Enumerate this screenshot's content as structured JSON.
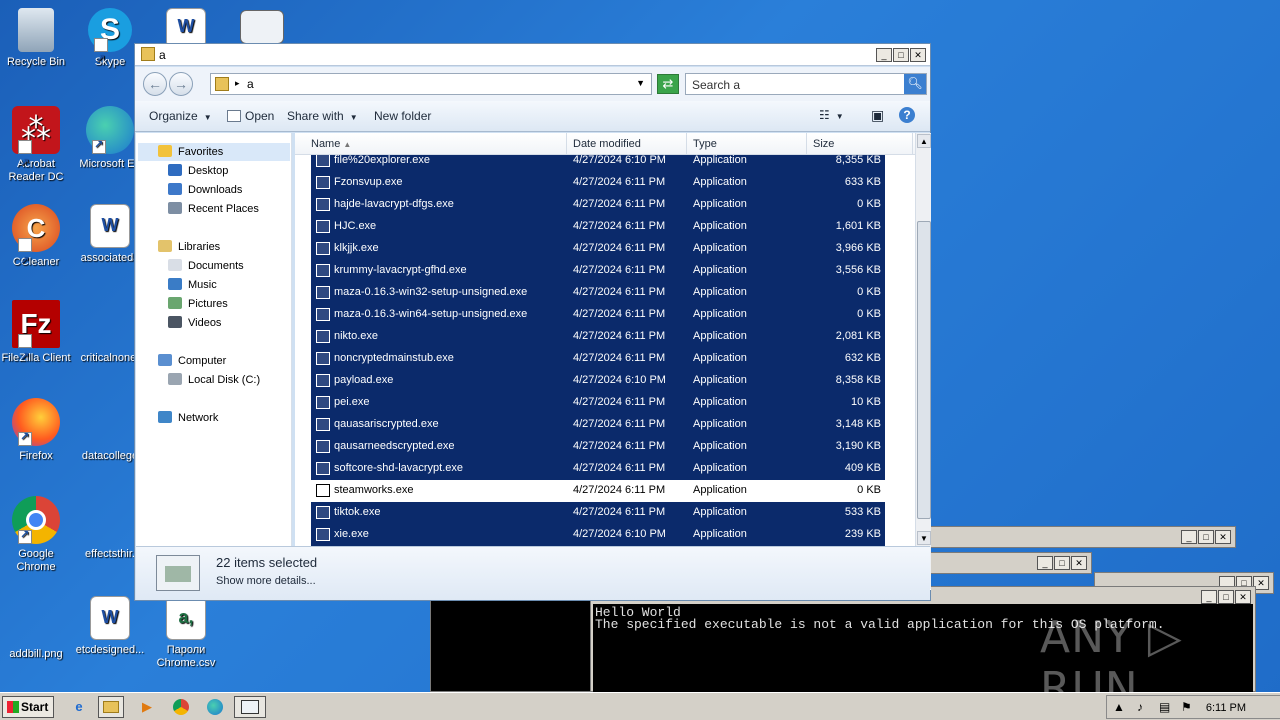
{
  "desktop": {
    "icons": [
      {
        "label": "Recycle Bin"
      },
      {
        "label": "Skype"
      },
      {
        "label": "Acrobat\nReader DC"
      },
      {
        "label": "Microsoft Ed"
      },
      {
        "label": "CCleaner"
      },
      {
        "label": "associateda"
      },
      {
        "label": "FileZilla Client"
      },
      {
        "label": "criticalnone."
      },
      {
        "label": "Firefox"
      },
      {
        "label": "datacollege"
      },
      {
        "label": "Google\nChrome"
      },
      {
        "label": "effectsthir."
      },
      {
        "label": "addbill.png"
      },
      {
        "label": "etcdesigned..."
      },
      {
        "label": "Пароли\nChrome.csv"
      }
    ]
  },
  "console": {
    "line1": "Hello World",
    "line2": "The specified executable is not a valid application for this OS platform."
  },
  "watermark": "ANY ▷ RUN",
  "explorer": {
    "title": "a",
    "address": "a",
    "search_placeholder": "Search a",
    "toolbar": {
      "organize": "Organize",
      "open": "Open",
      "share_with": "Share with",
      "new_folder": "New folder"
    },
    "nav": {
      "favorites": "Favorites",
      "desktop": "Desktop",
      "downloads": "Downloads",
      "recent_places": "Recent Places",
      "libraries": "Libraries",
      "documents": "Documents",
      "music": "Music",
      "pictures": "Pictures",
      "videos": "Videos",
      "computer": "Computer",
      "local_disk": "Local Disk (C:)",
      "network": "Network"
    },
    "columns": {
      "name": "Name",
      "date": "Date modified",
      "type": "Type",
      "size": "Size"
    },
    "files": [
      {
        "name": "file%20explorer.exe",
        "date": "4/27/2024 6:10 PM",
        "type": "Application",
        "size": "8,355 KB",
        "selected": true
      },
      {
        "name": "Fzonsvup.exe",
        "date": "4/27/2024 6:11 PM",
        "type": "Application",
        "size": "633 KB",
        "selected": true
      },
      {
        "name": "hajde-lavacrypt-dfgs.exe",
        "date": "4/27/2024 6:11 PM",
        "type": "Application",
        "size": "0 KB",
        "selected": true
      },
      {
        "name": "HJC.exe",
        "date": "4/27/2024 6:11 PM",
        "type": "Application",
        "size": "1,601 KB",
        "selected": true
      },
      {
        "name": "klkjjk.exe",
        "date": "4/27/2024 6:11 PM",
        "type": "Application",
        "size": "3,966 KB",
        "selected": true
      },
      {
        "name": "krummy-lavacrypt-gfhd.exe",
        "date": "4/27/2024 6:11 PM",
        "type": "Application",
        "size": "3,556 KB",
        "selected": true
      },
      {
        "name": "maza-0.16.3-win32-setup-unsigned.exe",
        "date": "4/27/2024 6:11 PM",
        "type": "Application",
        "size": "0 KB",
        "selected": true
      },
      {
        "name": "maza-0.16.3-win64-setup-unsigned.exe",
        "date": "4/27/2024 6:11 PM",
        "type": "Application",
        "size": "0 KB",
        "selected": true
      },
      {
        "name": "nikto.exe",
        "date": "4/27/2024 6:11 PM",
        "type": "Application",
        "size": "2,081 KB",
        "selected": true
      },
      {
        "name": "noncryptedmainstub.exe",
        "date": "4/27/2024 6:11 PM",
        "type": "Application",
        "size": "632 KB",
        "selected": true
      },
      {
        "name": "payload.exe",
        "date": "4/27/2024 6:10 PM",
        "type": "Application",
        "size": "8,358 KB",
        "selected": true
      },
      {
        "name": "pei.exe",
        "date": "4/27/2024 6:11 PM",
        "type": "Application",
        "size": "10 KB",
        "selected": true
      },
      {
        "name": "qauasariscrypted.exe",
        "date": "4/27/2024 6:11 PM",
        "type": "Application",
        "size": "3,148 KB",
        "selected": true
      },
      {
        "name": "qausarneedscrypted.exe",
        "date": "4/27/2024 6:11 PM",
        "type": "Application",
        "size": "3,190 KB",
        "selected": true
      },
      {
        "name": "softcore-shd-lavacrypt.exe",
        "date": "4/27/2024 6:11 PM",
        "type": "Application",
        "size": "409 KB",
        "selected": true
      },
      {
        "name": "steamworks.exe",
        "date": "4/27/2024 6:11 PM",
        "type": "Application",
        "size": "0 KB",
        "selected": false
      },
      {
        "name": "tiktok.exe",
        "date": "4/27/2024 6:11 PM",
        "type": "Application",
        "size": "533 KB",
        "selected": true
      },
      {
        "name": "xie.exe",
        "date": "4/27/2024 6:10 PM",
        "type": "Application",
        "size": "239 KB",
        "selected": true
      }
    ],
    "details": {
      "count": "22 items selected",
      "more": "Show more details..."
    }
  },
  "taskbar": {
    "start": "Start",
    "clock": "6:11 PM"
  }
}
